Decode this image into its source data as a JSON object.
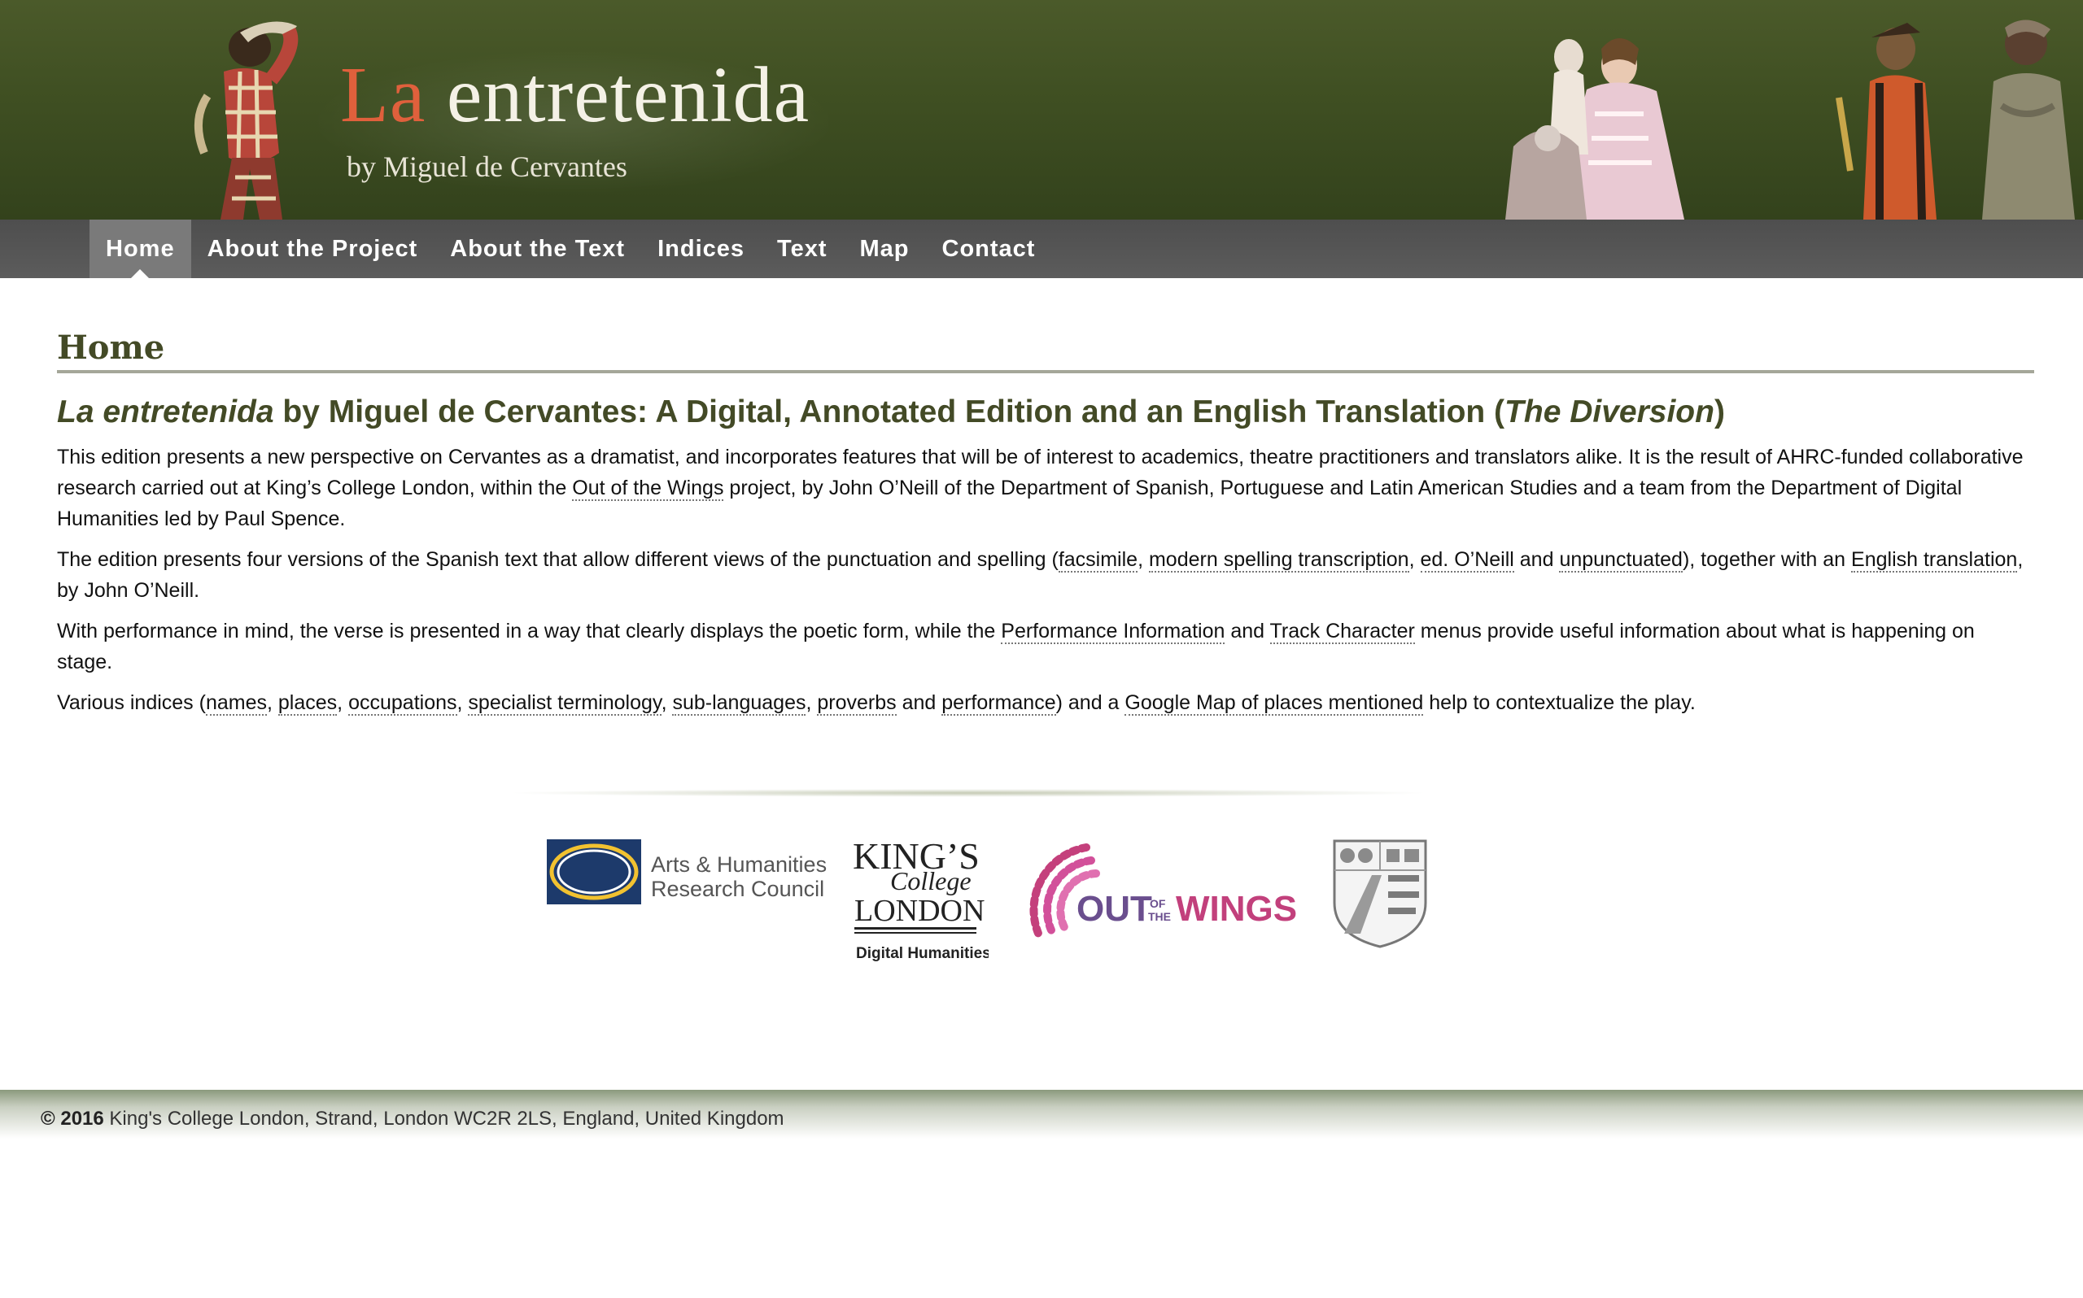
{
  "header": {
    "title_accent": "La",
    "title_rest": "entretenida",
    "subtitle": "by Miguel de Cervantes"
  },
  "nav": {
    "items": [
      {
        "label": "Home",
        "active": true
      },
      {
        "label": "About the Project"
      },
      {
        "label": "About the Text"
      },
      {
        "label": "Indices"
      },
      {
        "label": "Text"
      },
      {
        "label": "Map"
      },
      {
        "label": "Contact"
      }
    ]
  },
  "main": {
    "page_title": "Home",
    "lead": {
      "italic_title": "La entretenida",
      "middle": " by Miguel de Cervantes: A Digital, Annotated Edition and an English Translation (",
      "italic_translation": "The Diversion",
      "end": ")"
    },
    "p1": {
      "a": "This edition presents a new perspective on Cervantes as a dramatist, and incorporates features that will be of interest to academics, theatre practitioners and translators alike. It is the result of AHRC-funded collaborative research carried out at King’s College London, within the ",
      "link": "Out of the Wings",
      "b": " project, by John O’Neill of the Department of Spanish, Portuguese and Latin American Studies and a team from the Department of Digital Humanities led by Paul Spence."
    },
    "p2": {
      "a": "The edition presents four versions of the Spanish text that allow different views of the punctuation and spelling (",
      "l1": "facsimile",
      "s1": ", ",
      "l2": "modern spelling transcription",
      "s2": ", ",
      "l3": "ed. O’Neill",
      "s3": " and ",
      "l4": "unpunctuated",
      "s4": "), together with an ",
      "l5": "English translation",
      "b": ", by John O’Neill."
    },
    "p3": {
      "a": "With performance in mind, the verse is presented in a way that clearly displays the poetic form, while the ",
      "l1": "Performance Information",
      "s1": " and ",
      "l2": "Track Character",
      "b": " menus provide useful information about what is happening on stage."
    },
    "p4": {
      "a": "Various indices (",
      "l1": "names",
      "l2": "places",
      "l3": "occupations",
      "l4": "specialist terminology",
      "l5": "sub-languages",
      "l6": "proverbs",
      "l7": "performance",
      "sep": ", ",
      "and": " and ",
      "s1": ") and a ",
      "l8": "Google Map of places mentioned",
      "b": " help to contextualize the play."
    }
  },
  "logos": {
    "ahrc": {
      "line1": "Arts & Humanities",
      "line2": "Research Council"
    },
    "kings": {
      "line1": "KING’S",
      "line2": "College",
      "line3": "LONDON",
      "line4": "Digital Humanities"
    },
    "otw": {
      "out": "OUT",
      "of": "OF",
      "the": "THE",
      "wings": "WINGS"
    }
  },
  "footer": {
    "copyright": "© 2016",
    "address": " King's College London, Strand, London WC2R 2LS, England, United Kingdom"
  },
  "colors": {
    "banner": "#3f4f22",
    "title_accent": "#e0603c",
    "heading": "#434a26",
    "nav": "#555555",
    "nav_active": "#7a7a7a"
  }
}
